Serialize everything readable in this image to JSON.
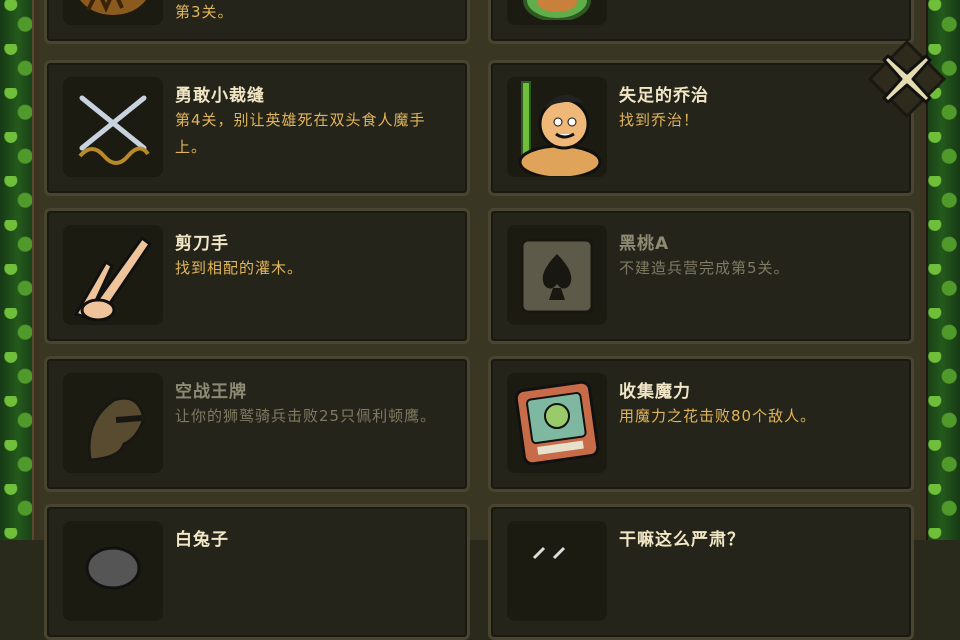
{
  "achievements": [
    {
      "title": "",
      "desc": "第3关。",
      "icon": "beast-icon",
      "locked": false
    },
    {
      "title": "",
      "desc": "",
      "icon": "turtle-icon",
      "locked": false
    },
    {
      "title": "勇敢小裁缝",
      "desc": "第4关，别让英雄死在双头食人魔手上。",
      "icon": "crossed-needles-icon",
      "locked": false
    },
    {
      "title": "失足的乔治",
      "desc": "找到乔治！",
      "icon": "george-icon",
      "locked": false
    },
    {
      "title": "剪刀手",
      "desc": "找到相配的灌木。",
      "icon": "scissors-hand-icon",
      "locked": false
    },
    {
      "title": "黑桃A",
      "desc": "不建造兵营完成第5关。",
      "icon": "ace-of-spades-icon",
      "locked": true
    },
    {
      "title": "空战王牌",
      "desc": "让你的狮鹫骑兵击败25只佩利顿鹰。",
      "icon": "griffin-rider-icon",
      "locked": true
    },
    {
      "title": "收集魔力",
      "desc": "用魔力之花击败80个敌人。",
      "icon": "magic-flower-card-icon",
      "locked": false
    },
    {
      "title": "白兔子",
      "desc": "",
      "icon": "rabbit-icon",
      "locked": false
    },
    {
      "title": "干嘛这么严肃？",
      "desc": "",
      "icon": "mask-icon",
      "locked": false
    }
  ],
  "close_button": {
    "icon": "close-x-icon"
  },
  "colors": {
    "title": "#f1e6c5",
    "desc": "#e0b45a",
    "locked": "#7f7a62"
  }
}
